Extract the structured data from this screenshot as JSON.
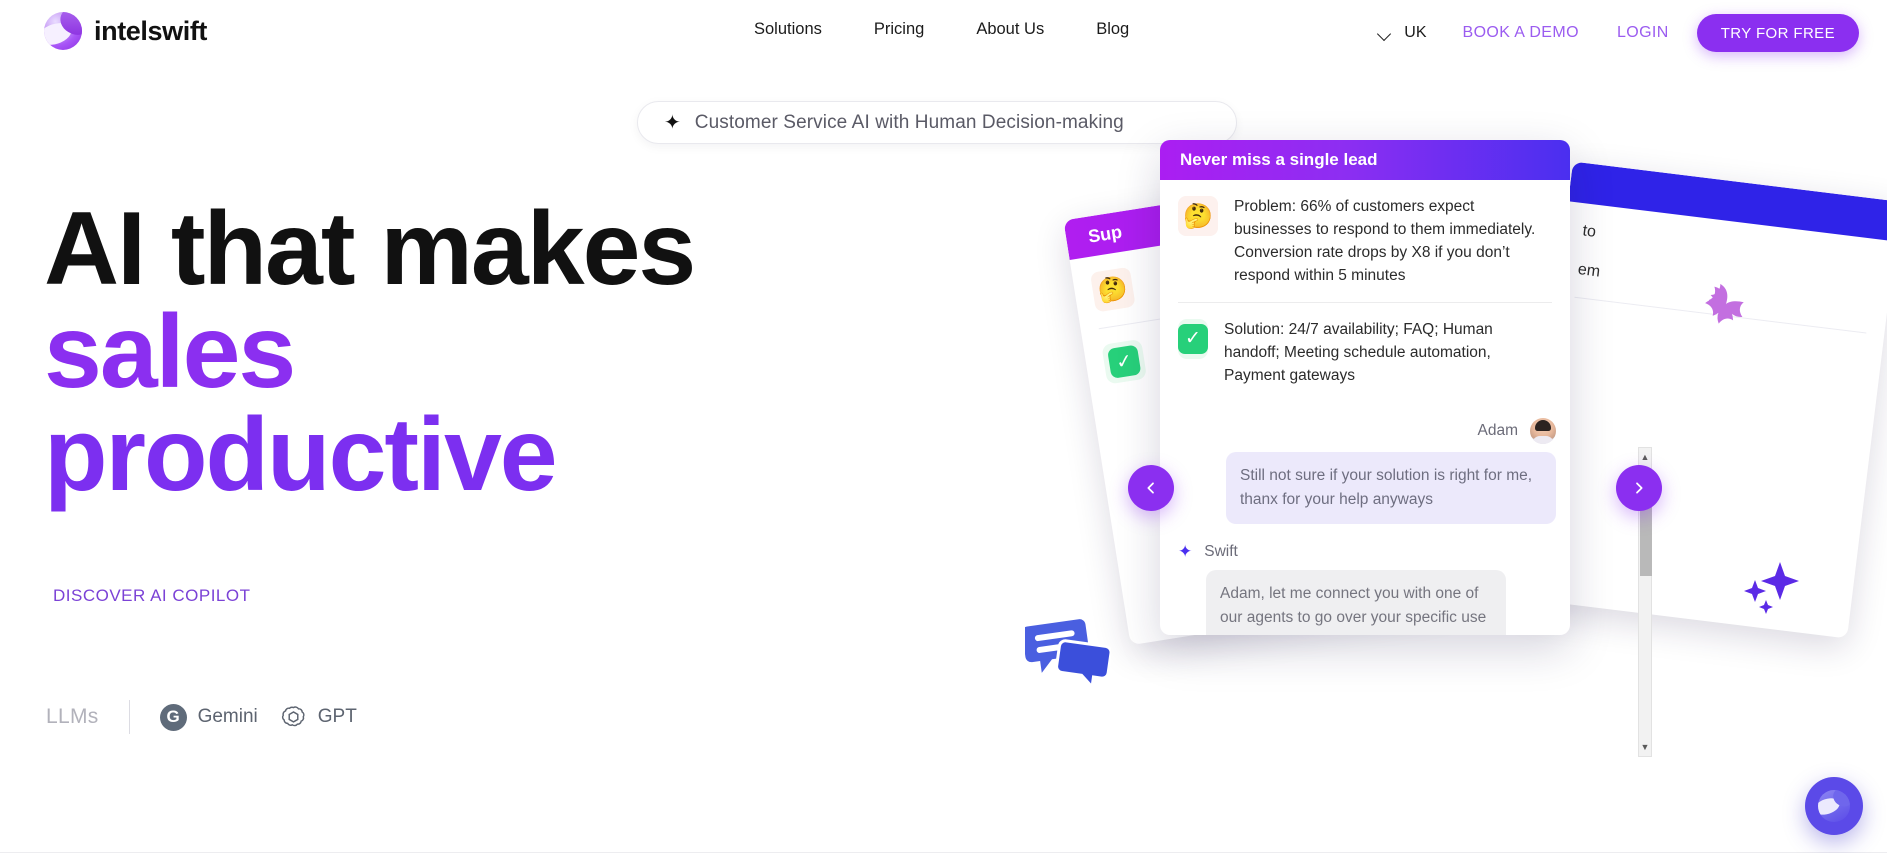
{
  "header": {
    "brand": {
      "name": "intelswift",
      "logo_icon": "intelswift-logo-icon"
    },
    "nav": [
      {
        "label": "Solutions"
      },
      {
        "label": "Pricing"
      },
      {
        "label": "About Us"
      },
      {
        "label": "Blog"
      }
    ],
    "locale": {
      "label": "UK",
      "icon": "chevron-down-icon"
    },
    "book_demo": "BOOK A DEMO",
    "login": "LOGIN",
    "try_free": "TRY FOR FREE",
    "accent": "#8b2ff0"
  },
  "hero": {
    "badge": {
      "icon": "sparkle-icon",
      "text": "Customer Service AI with Human Decision-making"
    },
    "heading_line1": "AI that makes",
    "heading_line2": "sales",
    "heading_line3": "productive",
    "cta": "DISCOVER AI COPILOT",
    "llms": {
      "label": "LLMs",
      "items": [
        {
          "name": "Gemini",
          "icon": "gemini-icon"
        },
        {
          "name": "GPT",
          "icon": "openai-gpt-icon"
        }
      ]
    }
  },
  "showcase": {
    "card": {
      "title": "Never miss a single lead",
      "problem": {
        "icon": "thinking-face-emoji",
        "text": "Problem: 66% of customers expect businesses to respond to them immediately. Conversion rate drops by X8 if you don’t respond within 5 minutes"
      },
      "solution": {
        "icon": "check-square-icon",
        "text": "Solution: 24/7 availability; FAQ; Human handoff; Meeting schedule automation, Payment gateways"
      },
      "chat": [
        {
          "sender": "Adam",
          "avatar": "user-avatar",
          "text": "Still not sure if your solution is right for me, thanx for your help anyways"
        },
        {
          "sender": "Swift",
          "avatar": "sparkle-icon",
          "text": "Adam, let me connect you with one of our agents to go over your specific use case"
        }
      ]
    },
    "back_card_left": {
      "title": "Sup"
    },
    "back_card_right": {
      "fragment_1": "to",
      "fragment_2": "em"
    },
    "prev_label": "‹",
    "next_label": "›",
    "scrollbar": {
      "up": "▲",
      "down": "▼"
    }
  },
  "widgets": {
    "chat_fab": "intelswift-chat-launcher"
  },
  "decorations": [
    {
      "name": "speech-bubbles-decoration"
    },
    {
      "name": "pinwheel-decoration"
    },
    {
      "name": "sparkles-decoration"
    }
  ]
}
